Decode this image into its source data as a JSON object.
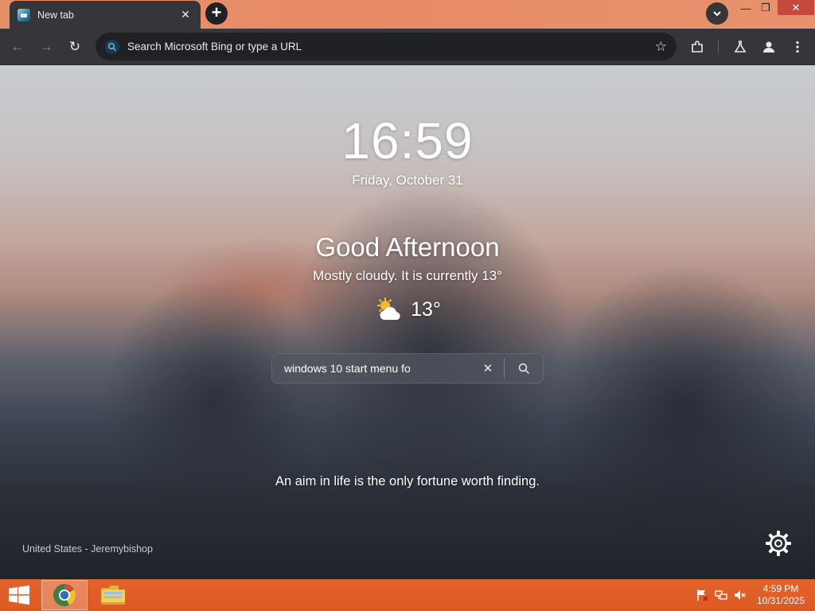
{
  "browser": {
    "tab": {
      "title": "New tab",
      "close_glyph": "✕"
    },
    "newtab_glyph": "+",
    "window_controls": {
      "minimize": "—",
      "maximize": "❐",
      "close": "✕"
    },
    "omnibox": {
      "placeholder": "Search Microsoft Bing or type a URL"
    },
    "nav": {
      "back": "←",
      "forward": "→",
      "reload": "↻"
    },
    "star_glyph": "☆"
  },
  "ntp": {
    "clock": "16:59",
    "date": "Friday, October 31",
    "greeting": "Good Afternoon",
    "weather": {
      "description": "Mostly cloudy. It is currently 13°",
      "temperature": "13°",
      "icon": "partly-cloudy-icon"
    },
    "search": {
      "value": "windows 10 start menu fo",
      "clear_glyph": "✕"
    },
    "quote": "An aim in life is the only fortune worth finding.",
    "location": "United States - Jeremybishop"
  },
  "taskbar": {
    "clock_time": "4:59 PM",
    "clock_date": "10/31/2025",
    "items": [
      "chrome-icon",
      "file-explorer-icon"
    ]
  },
  "colors": {
    "tabstrip": "#e98b68",
    "toolbar": "#35363a",
    "omnibox": "#202124",
    "taskbar": "#dc5a24",
    "close_button": "#c7483c"
  }
}
